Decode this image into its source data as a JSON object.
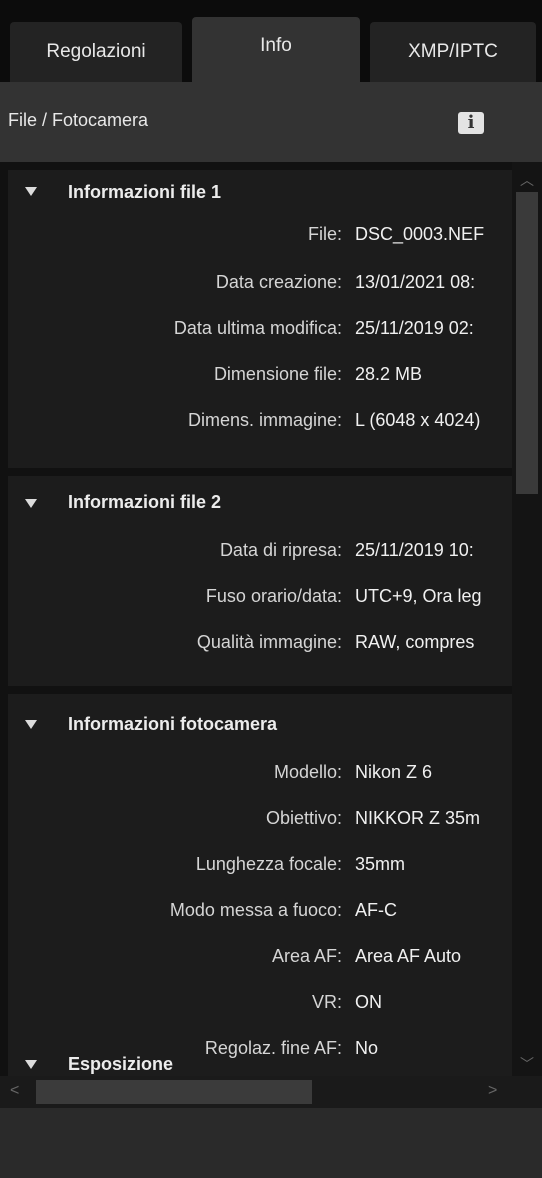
{
  "tabs": [
    {
      "label": "Regolazioni"
    },
    {
      "label": "Info"
    },
    {
      "label": "XMP/IPTC"
    }
  ],
  "section": {
    "title": "File / Fotocamera",
    "info_icon": "info-icon",
    "info_glyph": "i"
  },
  "groups": [
    {
      "title": "Informazioni file 1",
      "rows": [
        {
          "label": "File:",
          "value": "DSC_0003.NEF"
        },
        {
          "label": "Data creazione:",
          "value": "13/01/2021 08:"
        },
        {
          "label": "Data ultima modifica:",
          "value": "25/11/2019 02:"
        },
        {
          "label": "Dimensione file:",
          "value": "28.2 MB"
        },
        {
          "label": "Dimens. immagine:",
          "value": "L (6048 x 4024)"
        }
      ]
    },
    {
      "title": "Informazioni file 2",
      "rows": [
        {
          "label": "Data di ripresa:",
          "value": "25/11/2019 10:"
        },
        {
          "label": "Fuso orario/data:",
          "value": "UTC+9, Ora leg"
        },
        {
          "label": "Qualità immagine:",
          "value": "RAW, compres"
        }
      ]
    },
    {
      "title": "Informazioni fotocamera",
      "rows": [
        {
          "label": "Modello:",
          "value": "Nikon Z 6"
        },
        {
          "label": "Obiettivo:",
          "value": "NIKKOR Z 35m"
        },
        {
          "label": "Lunghezza focale:",
          "value": "35mm"
        },
        {
          "label": "Modo messa a fuoco:",
          "value": "AF-C"
        },
        {
          "label": "Area AF:",
          "value": "Area AF Auto"
        },
        {
          "label": "VR:",
          "value": "ON"
        },
        {
          "label": "Regolaz. fine AF:",
          "value": "No"
        }
      ]
    },
    {
      "title": "Esposizione",
      "rows": []
    }
  ],
  "scrollbars": {
    "vertical": {
      "up_glyph": "︿",
      "down_glyph": "﹀"
    },
    "horizontal": {
      "left_glyph": "<",
      "right_glyph": ">"
    }
  }
}
